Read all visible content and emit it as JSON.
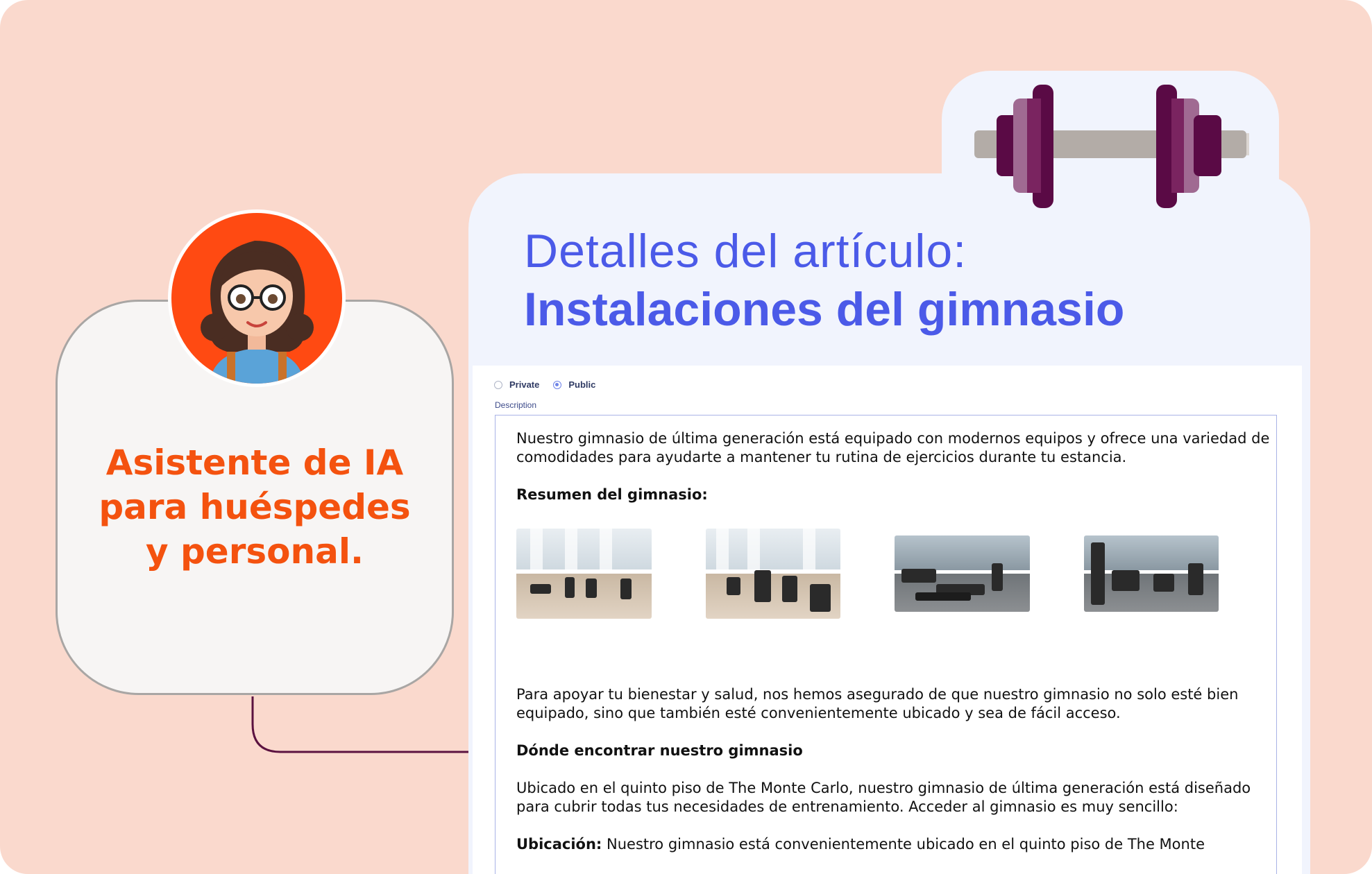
{
  "assistant": {
    "line1": "Asistente de IA",
    "line2": "para huéspedes",
    "line3": "y personal."
  },
  "article": {
    "title_prefix": "Detalles del artículo:",
    "title_main": "Instalaciones del gimnasio"
  },
  "visibility": {
    "options": [
      {
        "label": "Private",
        "selected": false
      },
      {
        "label": "Public",
        "selected": true
      }
    ]
  },
  "description": {
    "label": "Description",
    "intro": "Nuestro gimnasio de última generación está equipado con modernos equipos y ofrece una variedad de comodidades para ayudarte a mantener tu rutina de ejercicios durante tu estancia.",
    "summary_heading": "Resumen del gimnasio:",
    "wellbeing": "Para apoyar tu bienestar y salud, nos hemos asegurado de que nuestro gimnasio no solo esté bien equipado, sino que también esté convenientemente ubicado y sea de fácil acceso.",
    "where_heading": "Dónde encontrar nuestro gimnasio",
    "location_para": "Ubicado en el quinto piso de The Monte Carlo, nuestro gimnasio de última generación está diseñado para cubrir todas tus necesidades de entrenamiento. Acceder al gimnasio es muy sencillo:",
    "ubicacion_label": "Ubicación:",
    "ubicacion_text": "Nuestro gimnasio está convenientemente ubicado en el quinto piso de The Monte"
  },
  "icons": {
    "dumbbell": "dumbbell-icon",
    "avatar": "assistant-avatar"
  },
  "colors": {
    "background": "#fad9cd",
    "accent_orange": "#f4520f",
    "title_blue": "#4b5ae8",
    "dumbbell_dark": "#5a0a45",
    "dumbbell_light": "#a06a92"
  }
}
